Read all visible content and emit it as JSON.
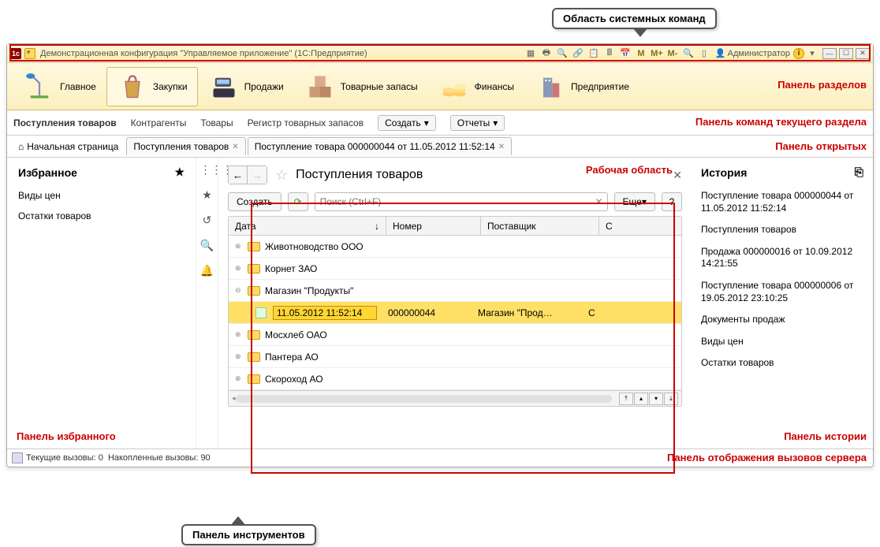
{
  "callouts": {
    "top": "Область системных команд",
    "bottom": "Панель инструментов"
  },
  "red_labels": {
    "sections": "Панель разделов",
    "commands": "Панель команд текущего раздела",
    "open": "Панель открытых",
    "workarea": "Рабочая область",
    "favorites": "Панель избранного",
    "history": "Панель истории",
    "status": "Панель отображения вызовов сервера"
  },
  "titlebar": {
    "text": "Демонстрационная конфигурация \"Управляемое приложение\"  (1С:Предприятие)",
    "m": "M",
    "mplus": "M+",
    "mminus": "M-",
    "user": "Администратор"
  },
  "sections": [
    {
      "label": "Главное"
    },
    {
      "label": "Закупки"
    },
    {
      "label": "Продажи"
    },
    {
      "label": "Товарные запасы"
    },
    {
      "label": "Финансы"
    },
    {
      "label": "Предприятие"
    }
  ],
  "commands": {
    "links": [
      "Поступления товаров",
      "Контрагенты",
      "Товары",
      "Регистр товарных запасов"
    ],
    "create": "Создать",
    "reports": "Отчеты"
  },
  "tabs": {
    "home": "Начальная страница",
    "tab1": "Поступления товаров",
    "tab2": "Поступление товара 000000044 от 11.05.2012 11:52:14"
  },
  "favorites": {
    "title": "Избранное",
    "items": [
      "Виды цен",
      "Остатки товаров"
    ]
  },
  "workarea": {
    "title": "Поступления товаров",
    "create": "Создать",
    "search_placeholder": "Поиск (Ctrl+F)",
    "more": "Еще",
    "help": "?",
    "headers": {
      "date": "Дата",
      "number": "Номер",
      "supplier": "Поставщик",
      "sum": "С"
    },
    "rows": [
      {
        "type": "group",
        "text": "Животноводство ООО"
      },
      {
        "type": "group",
        "text": "Корнет ЗАО"
      },
      {
        "type": "group-open",
        "text": "Магазин \"Продукты\""
      },
      {
        "type": "doc",
        "date": "11.05.2012 11:52:14",
        "number": "000000044",
        "supplier": "Магазин \"Прод…",
        "sum": "С"
      },
      {
        "type": "group",
        "text": "Мосхлеб ОАО"
      },
      {
        "type": "group",
        "text": "Пантера АО"
      },
      {
        "type": "group",
        "text": "Скороход АО"
      }
    ]
  },
  "history": {
    "title": "История",
    "items": [
      "Поступление товара 000000044 от 11.05.2012 11:52:14",
      "Поступления товаров",
      "Продажа 000000016 от 10.09.2012 14:21:55",
      "Поступление товара 000000006 от 19.05.2012 23:10:25",
      "Документы продаж",
      "Виды цен",
      "Остатки товаров"
    ]
  },
  "status": {
    "current_label": "Текущие вызовы:",
    "current_val": "0",
    "accum_label": "Накопленные вызовы:",
    "accum_val": "90"
  }
}
